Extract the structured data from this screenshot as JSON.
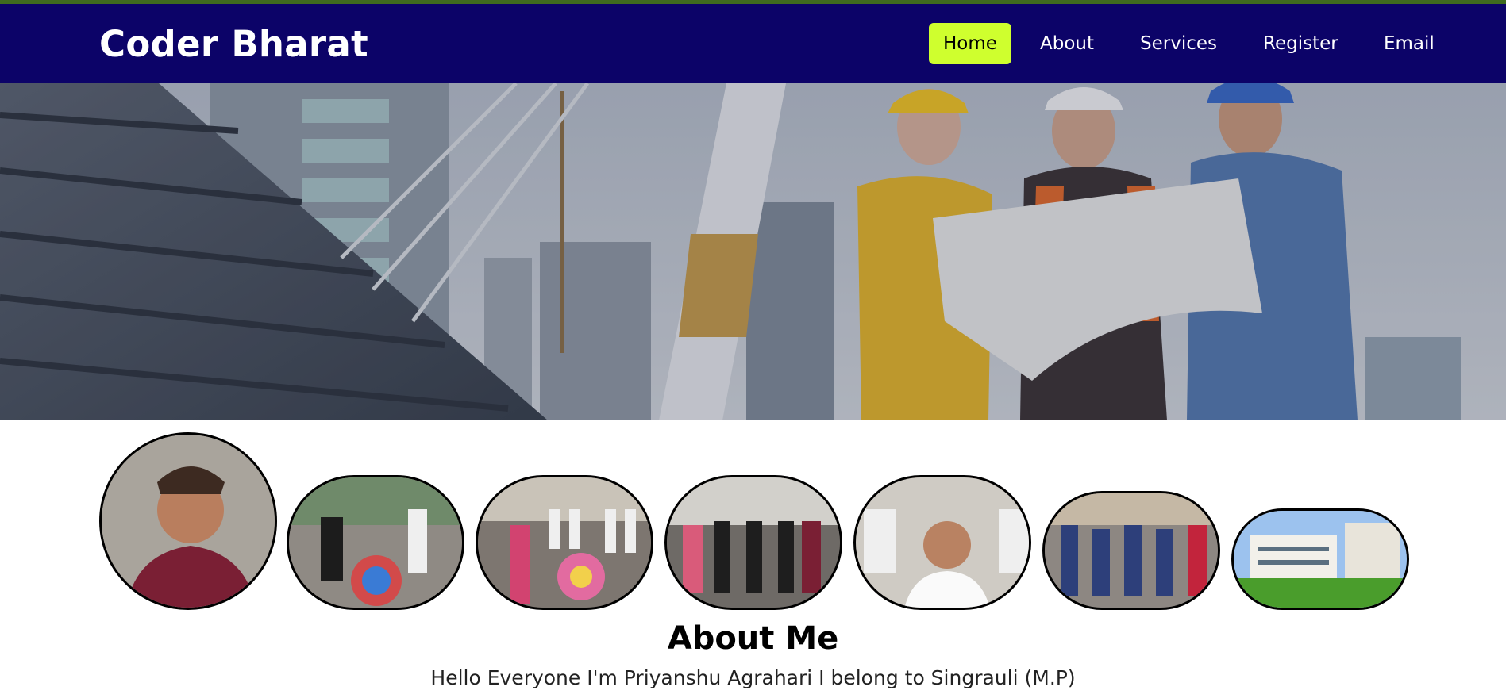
{
  "brand": "Coder Bharat",
  "nav": {
    "items": [
      {
        "label": "Home",
        "active": true
      },
      {
        "label": "About",
        "active": false
      },
      {
        "label": "Services",
        "active": false
      },
      {
        "label": "Register",
        "active": false
      },
      {
        "label": "Email",
        "active": false
      }
    ]
  },
  "hero": {
    "image": "construction workers reviewing blueprint in front of city buildings"
  },
  "gallery": {
    "photos": [
      "person selfie",
      "rangoli activity group",
      "rangoli and students",
      "group standing in hall",
      "classroom selfie",
      "group photo",
      "campus building"
    ]
  },
  "about": {
    "title": "About Me",
    "text": "Hello Everyone I'm Priyanshu Agrahari I belong to Singrauli (M.P)"
  },
  "colors": {
    "top_strip": "#3f6b1f",
    "navbar_bg": "#0c0368",
    "nav_active_bg": "#cfff2e",
    "nav_text": "#ffffff"
  }
}
